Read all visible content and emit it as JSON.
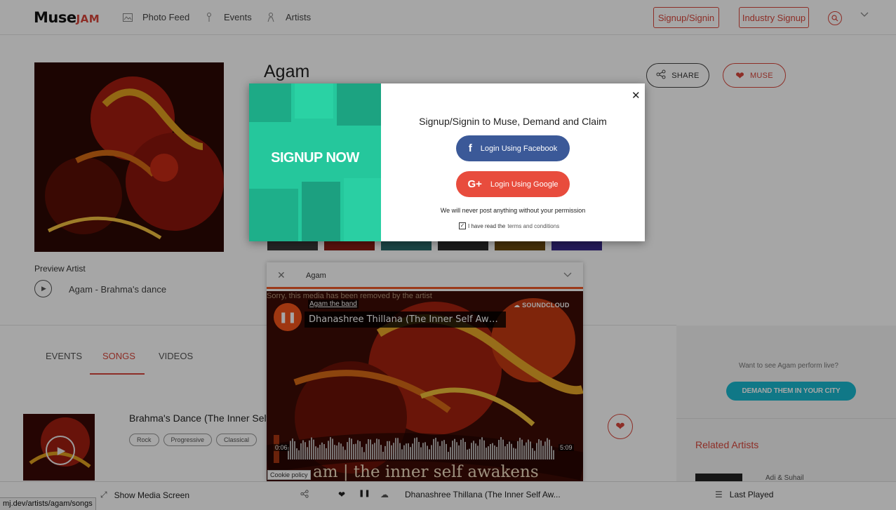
{
  "header": {
    "logo_muse": "Muse",
    "logo_jam": "JAM",
    "nav": [
      {
        "label": "Photo Feed"
      },
      {
        "label": "Events"
      },
      {
        "label": "Artists"
      }
    ],
    "signup_label": "Signup/Signin",
    "industry_label": "Industry Signup"
  },
  "artist": {
    "name": "Agam",
    "share_label": "SHARE",
    "muse_label": "MUSE",
    "preview_label": "Preview Artist",
    "preview_song": "Agam - Brahma's dance"
  },
  "tabs": [
    "EVENTS",
    "SONGS",
    "VIDEOS"
  ],
  "active_tab": "SONGS",
  "song": {
    "title": "Brahma's Dance (The Inner Self Awakens)",
    "tags": [
      "Rock",
      "Progressive",
      "Classical"
    ]
  },
  "sidebar": {
    "perform_text": "Want to see Agam perform live?",
    "demand_label": "DEMAND THEM IN YOUR CITY",
    "related_title": "Related Artists",
    "related_name": "Adi & Suhail"
  },
  "player": {
    "title": "Agam",
    "removed_text": "Sorry, this media has been removed by the artist",
    "sc_user": "Agam the band",
    "sc_track": "Dhanashree Thillana (The Inner Self Awakens)",
    "sc_logo": "SOUNDCLOUD",
    "time_elapsed": "0:06",
    "time_total": "5:09",
    "album_text": "am | the inner self awakens",
    "progress": 0.02,
    "cookie_label": "Cookie policy"
  },
  "bottom_bar": {
    "show_media": "Show Media Screen",
    "now_playing": "Dhanashree Thillana (The Inner Self Aw...",
    "last_played": "Last Played"
  },
  "status_url": "mj.dev/artists/agam/songs",
  "modal": {
    "signup_now": "SIGNUP NOW",
    "heading": "Signup/Signin to Muse, Demand and Claim",
    "facebook_label": "Login Using Facebook",
    "google_label": "Login Using Google",
    "permission_text": "We will never post anything without your permission",
    "terms_prefix": "I have read the",
    "terms_link": "terms and conditions"
  },
  "colors": {
    "accent": "#d9473c",
    "facebook": "#3b5998",
    "google": "#e84c3d",
    "demand": "#19b9cf",
    "soundcloud": "#f5551b",
    "signup_panel": "#24c49a"
  }
}
